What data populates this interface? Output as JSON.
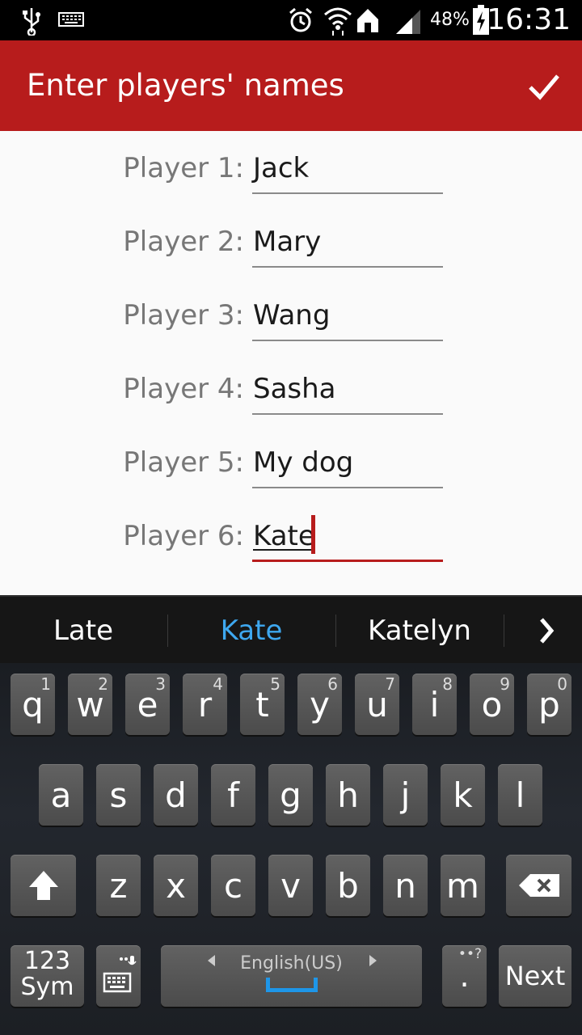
{
  "status_bar": {
    "battery_percent": "48%",
    "time": "16:31",
    "icons": [
      "usb-icon",
      "keyboard-notification-icon",
      "alarm-icon",
      "wifi-icon",
      "home-icon",
      "signal-icon",
      "battery-charging-icon"
    ]
  },
  "action_bar": {
    "title": "Enter players' names",
    "confirm_icon": "check-icon",
    "color": "#b71c1c"
  },
  "players": [
    {
      "label": "Player 1:",
      "value": "Jack"
    },
    {
      "label": "Player 2:",
      "value": "Mary"
    },
    {
      "label": "Player 3:",
      "value": "Wang"
    },
    {
      "label": "Player 4:",
      "value": "Sasha"
    },
    {
      "label": "Player 5:",
      "value": "My dog"
    },
    {
      "label": "Player 6:",
      "value": "Kate"
    }
  ],
  "active_field_index": 5,
  "suggestions": {
    "items": [
      "Late",
      "Kate",
      "Katelyn"
    ],
    "highlighted": "Kate",
    "more_icon": "chevron-right-icon"
  },
  "keyboard": {
    "row1": [
      {
        "key": "q",
        "hint": "1"
      },
      {
        "key": "w",
        "hint": "2"
      },
      {
        "key": "e",
        "hint": "3"
      },
      {
        "key": "r",
        "hint": "4"
      },
      {
        "key": "t",
        "hint": "5"
      },
      {
        "key": "y",
        "hint": "6"
      },
      {
        "key": "u",
        "hint": "7"
      },
      {
        "key": "i",
        "hint": "8"
      },
      {
        "key": "o",
        "hint": "9"
      },
      {
        "key": "p",
        "hint": "0"
      }
    ],
    "row2": [
      "a",
      "s",
      "d",
      "f",
      "g",
      "h",
      "j",
      "k",
      "l"
    ],
    "row3": [
      "z",
      "x",
      "c",
      "v",
      "b",
      "n",
      "m"
    ],
    "sym_line1": "123",
    "sym_line2": "Sym",
    "space_language": "English(US)",
    "period": ".",
    "period_hint": "••?",
    "next_label": "Next",
    "shift_icon": "shift-arrow-icon",
    "backspace_icon": "backspace-icon",
    "keyboard_settings_icon": "keyboard-mic-icon",
    "accent_color": "#1e96e8"
  }
}
